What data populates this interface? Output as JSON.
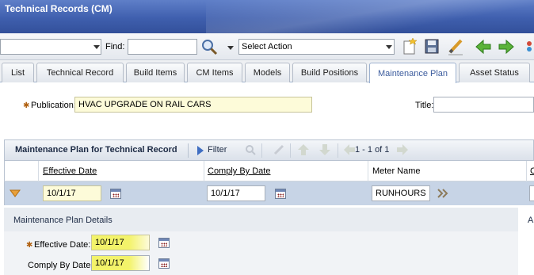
{
  "window": {
    "title": "Technical Records (CM)"
  },
  "toolbar": {
    "first_select_value": "",
    "find_label": "Find:",
    "find_value": "",
    "action_select_value": "Select Action"
  },
  "tabs": [
    {
      "label": "List"
    },
    {
      "label": "Technical Record"
    },
    {
      "label": "Build Items"
    },
    {
      "label": "CM Items"
    },
    {
      "label": "Models"
    },
    {
      "label": "Build Positions"
    },
    {
      "label": "Maintenance Plan",
      "active": true
    },
    {
      "label": "Asset Status"
    }
  ],
  "header": {
    "publication_label": "Publication:",
    "publication_value": "HVAC UPGRADE ON RAIL CARS",
    "title_label": "Title:",
    "title_value": ""
  },
  "grid": {
    "title": "Maintenance Plan for Technical Record",
    "filter_label": "Filter",
    "paging": "1 - 1 of 1",
    "columns": [
      "Effective Date",
      "Comply By Date",
      "Meter Name",
      "C"
    ],
    "row": {
      "effective_date": "10/1/17",
      "comply_by_date": "10/1/17",
      "meter_name": "RUNHOURS"
    }
  },
  "details": {
    "title": "Maintenance Plan Details",
    "right_letter": "A",
    "effective_date_label": "Effective Date:",
    "effective_date_value": "10/1/17",
    "comply_by_label": "Comply By Date:",
    "comply_by_value": "10/1/17"
  },
  "colors": {
    "accent": "#3d5d9e",
    "highlight": "#f3f36a",
    "titlebar": "#4a68b5",
    "row_selected": "#c7d4e6"
  },
  "icons": [
    "search-icon",
    "new-document-icon",
    "save-icon",
    "edit-icon",
    "back-arrow-icon",
    "forward-arrow-icon",
    "filter-icon",
    "calendar-icon",
    "expand-arrow-icon",
    "double-chevron-icon"
  ]
}
